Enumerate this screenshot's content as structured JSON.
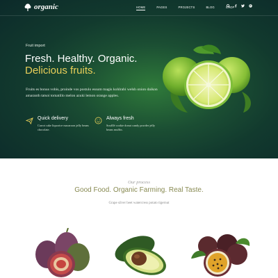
{
  "header": {
    "logo_text": "organic",
    "nav": [
      "HOME",
      "PAGES",
      "PROJECTS",
      "BLOG",
      "SHOP"
    ],
    "icons": [
      "search-icon",
      "facebook-icon",
      "twitter-icon",
      "pinterest-icon"
    ]
  },
  "hero": {
    "kicker": "Fruit import",
    "headline": "Fresh. Healthy. Organic.",
    "headline_highlight": "Delicious fruits.",
    "lead": "Fruits es bonus vobis, proinde vos postulo essum magis kohlrabi welsh onion daikon amaranth tatsoi tomatillo melon azuki lemon orange apples.",
    "features": [
      {
        "icon": "paper-plane-icon",
        "title": "Quick delivery",
        "desc": "Carrot cake liquorice macaroon jelly beans chocolate."
      },
      {
        "icon": "smile-icon",
        "title": "Always fresh",
        "desc": "Soufflé cookie donut candy powder jelly beans muffin."
      }
    ],
    "colors": {
      "accent": "#e8cf59",
      "bg_dark": "#123a2e"
    }
  },
  "intro": {
    "kicker": "Our process",
    "title": "Good Food. Organic Farming. Real Taste.",
    "subtitle": "Grape silver beet watercress potato tigernut"
  },
  "products": [
    "figs",
    "avocado",
    "passion fruit"
  ]
}
